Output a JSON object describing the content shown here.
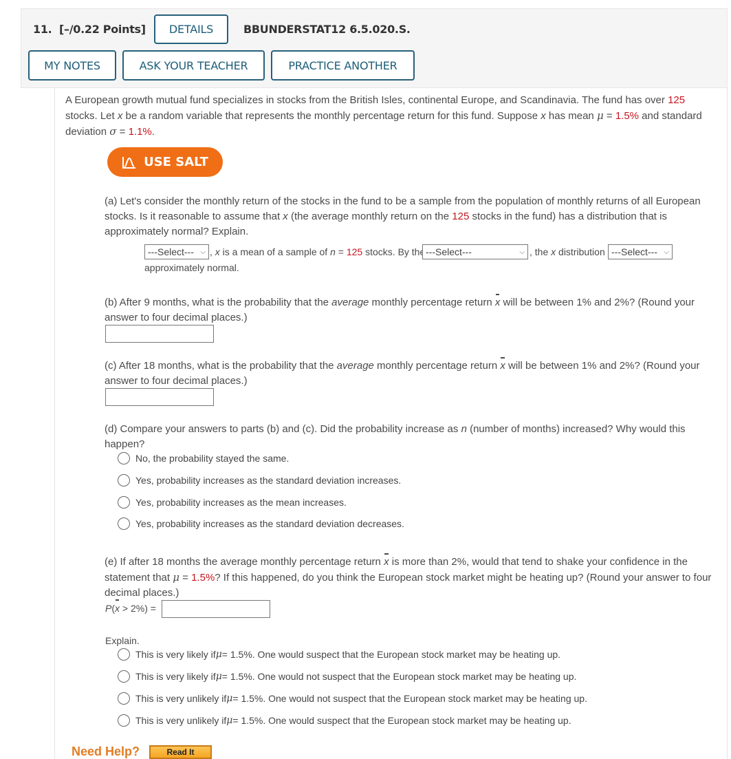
{
  "header": {
    "question_number": "11.",
    "points": "[–/0.22 Points]",
    "details_label": "DETAILS",
    "problem_code": "BBUNDERSTAT12 6.5.020.S.",
    "my_notes_label": "MY NOTES",
    "ask_teacher_label": "ASK YOUR TEACHER",
    "practice_another_label": "PRACTICE ANOTHER"
  },
  "intro": {
    "t1": "A European growth mutual fund specializes in stocks from the British Isles, continental Europe, and Scandinavia. The fund has over ",
    "n_stocks": "125",
    "t2": " stocks. Let ",
    "x": "x",
    "t3": " be a random variable that represents the monthly percentage return for this fund. Suppose ",
    "t4": " has mean ",
    "mu": "μ",
    "eq": " = ",
    "mean": "1.5%",
    "t5": " and standard deviation ",
    "sigma": "σ",
    "sd": "1.1%",
    "t6": "."
  },
  "salt_button": {
    "label": "USE SALT",
    "icon": "distribution-curve-icon"
  },
  "part_a": {
    "text1": "(a) Let's consider the monthly return of the stocks in the fund to be a sample from the population of monthly returns of all European stocks. Is it reasonable to assume that ",
    "x": "x",
    "text2": " (the average monthly return on the ",
    "n": "125",
    "text3": " stocks in the fund) has a distribution that is approximately normal? Explain.",
    "select1": "---Select---",
    "mid1": ", ",
    "mid2": " is a mean of a sample of ",
    "n_var": "n",
    "mid3": " = ",
    "mid4": " stocks. By the ",
    "select2": "---Select---",
    "mid5": ", the ",
    "mid6": " distribution ",
    "select3": "---Select---",
    "end": "approximately normal."
  },
  "part_b": {
    "text1": "(b) After 9 months, what is the probability that the ",
    "average": "average",
    "text2": " monthly percentage return ",
    "x": "x",
    "text3": " will be between 1% and 2%? (Round your answer to four decimal places.)",
    "answer": ""
  },
  "part_c": {
    "text1": "(c) After 18 months, what is the probability that the ",
    "average": "average",
    "text2": " monthly percentage return ",
    "x": "x",
    "text3": " will be between 1% and 2%? (Round your answer to four decimal places.)",
    "answer": ""
  },
  "part_d": {
    "text1": "(d) Compare your answers to parts (b) and (c). Did the probability increase as ",
    "n": "n",
    "text2": " (number of months) increased? Why would this happen?",
    "options": [
      "No, the probability stayed the same.",
      "Yes, probability increases as the standard deviation increases.",
      "Yes, probability increases as the mean increases.",
      "Yes, probability increases as the standard deviation decreases."
    ]
  },
  "part_e": {
    "text1": "(e) If after 18 months the average monthly percentage return ",
    "x": "x",
    "text2": " is more than 2%, would that tend to shake your confidence in the statement that ",
    "mu": "μ",
    "eq": " = ",
    "mean": "1.5%",
    "text3": "? If this happened, do you think the European stock market might be heating up? (Round your answer to four decimal places.)",
    "prob_P": "P",
    "prob_open": "(",
    "prob_rest": " > 2%) = ",
    "answer": "",
    "explain_label": "Explain.",
    "options": [
      {
        "pre": "This is very likely if ",
        "post": " = 1.5%. One would suspect that the European stock market may be heating up."
      },
      {
        "pre": "This is very likely if ",
        "post": " = 1.5%. One would not suspect that the European stock market may be heating up."
      },
      {
        "pre": "This is very unlikely if ",
        "post": " = 1.5%. One would not suspect that the European stock market may be heating up."
      },
      {
        "pre": "This is very unlikely if ",
        "post": " = 1.5%. One would suspect that the European stock market may be heating up."
      }
    ]
  },
  "help": {
    "label": "Need Help?",
    "read_it": "Read It"
  },
  "colors": {
    "accent_red": "#c5161d",
    "salt_orange": "#f06e15",
    "button_teal": "#26607a",
    "help_orange": "#e07d24"
  }
}
